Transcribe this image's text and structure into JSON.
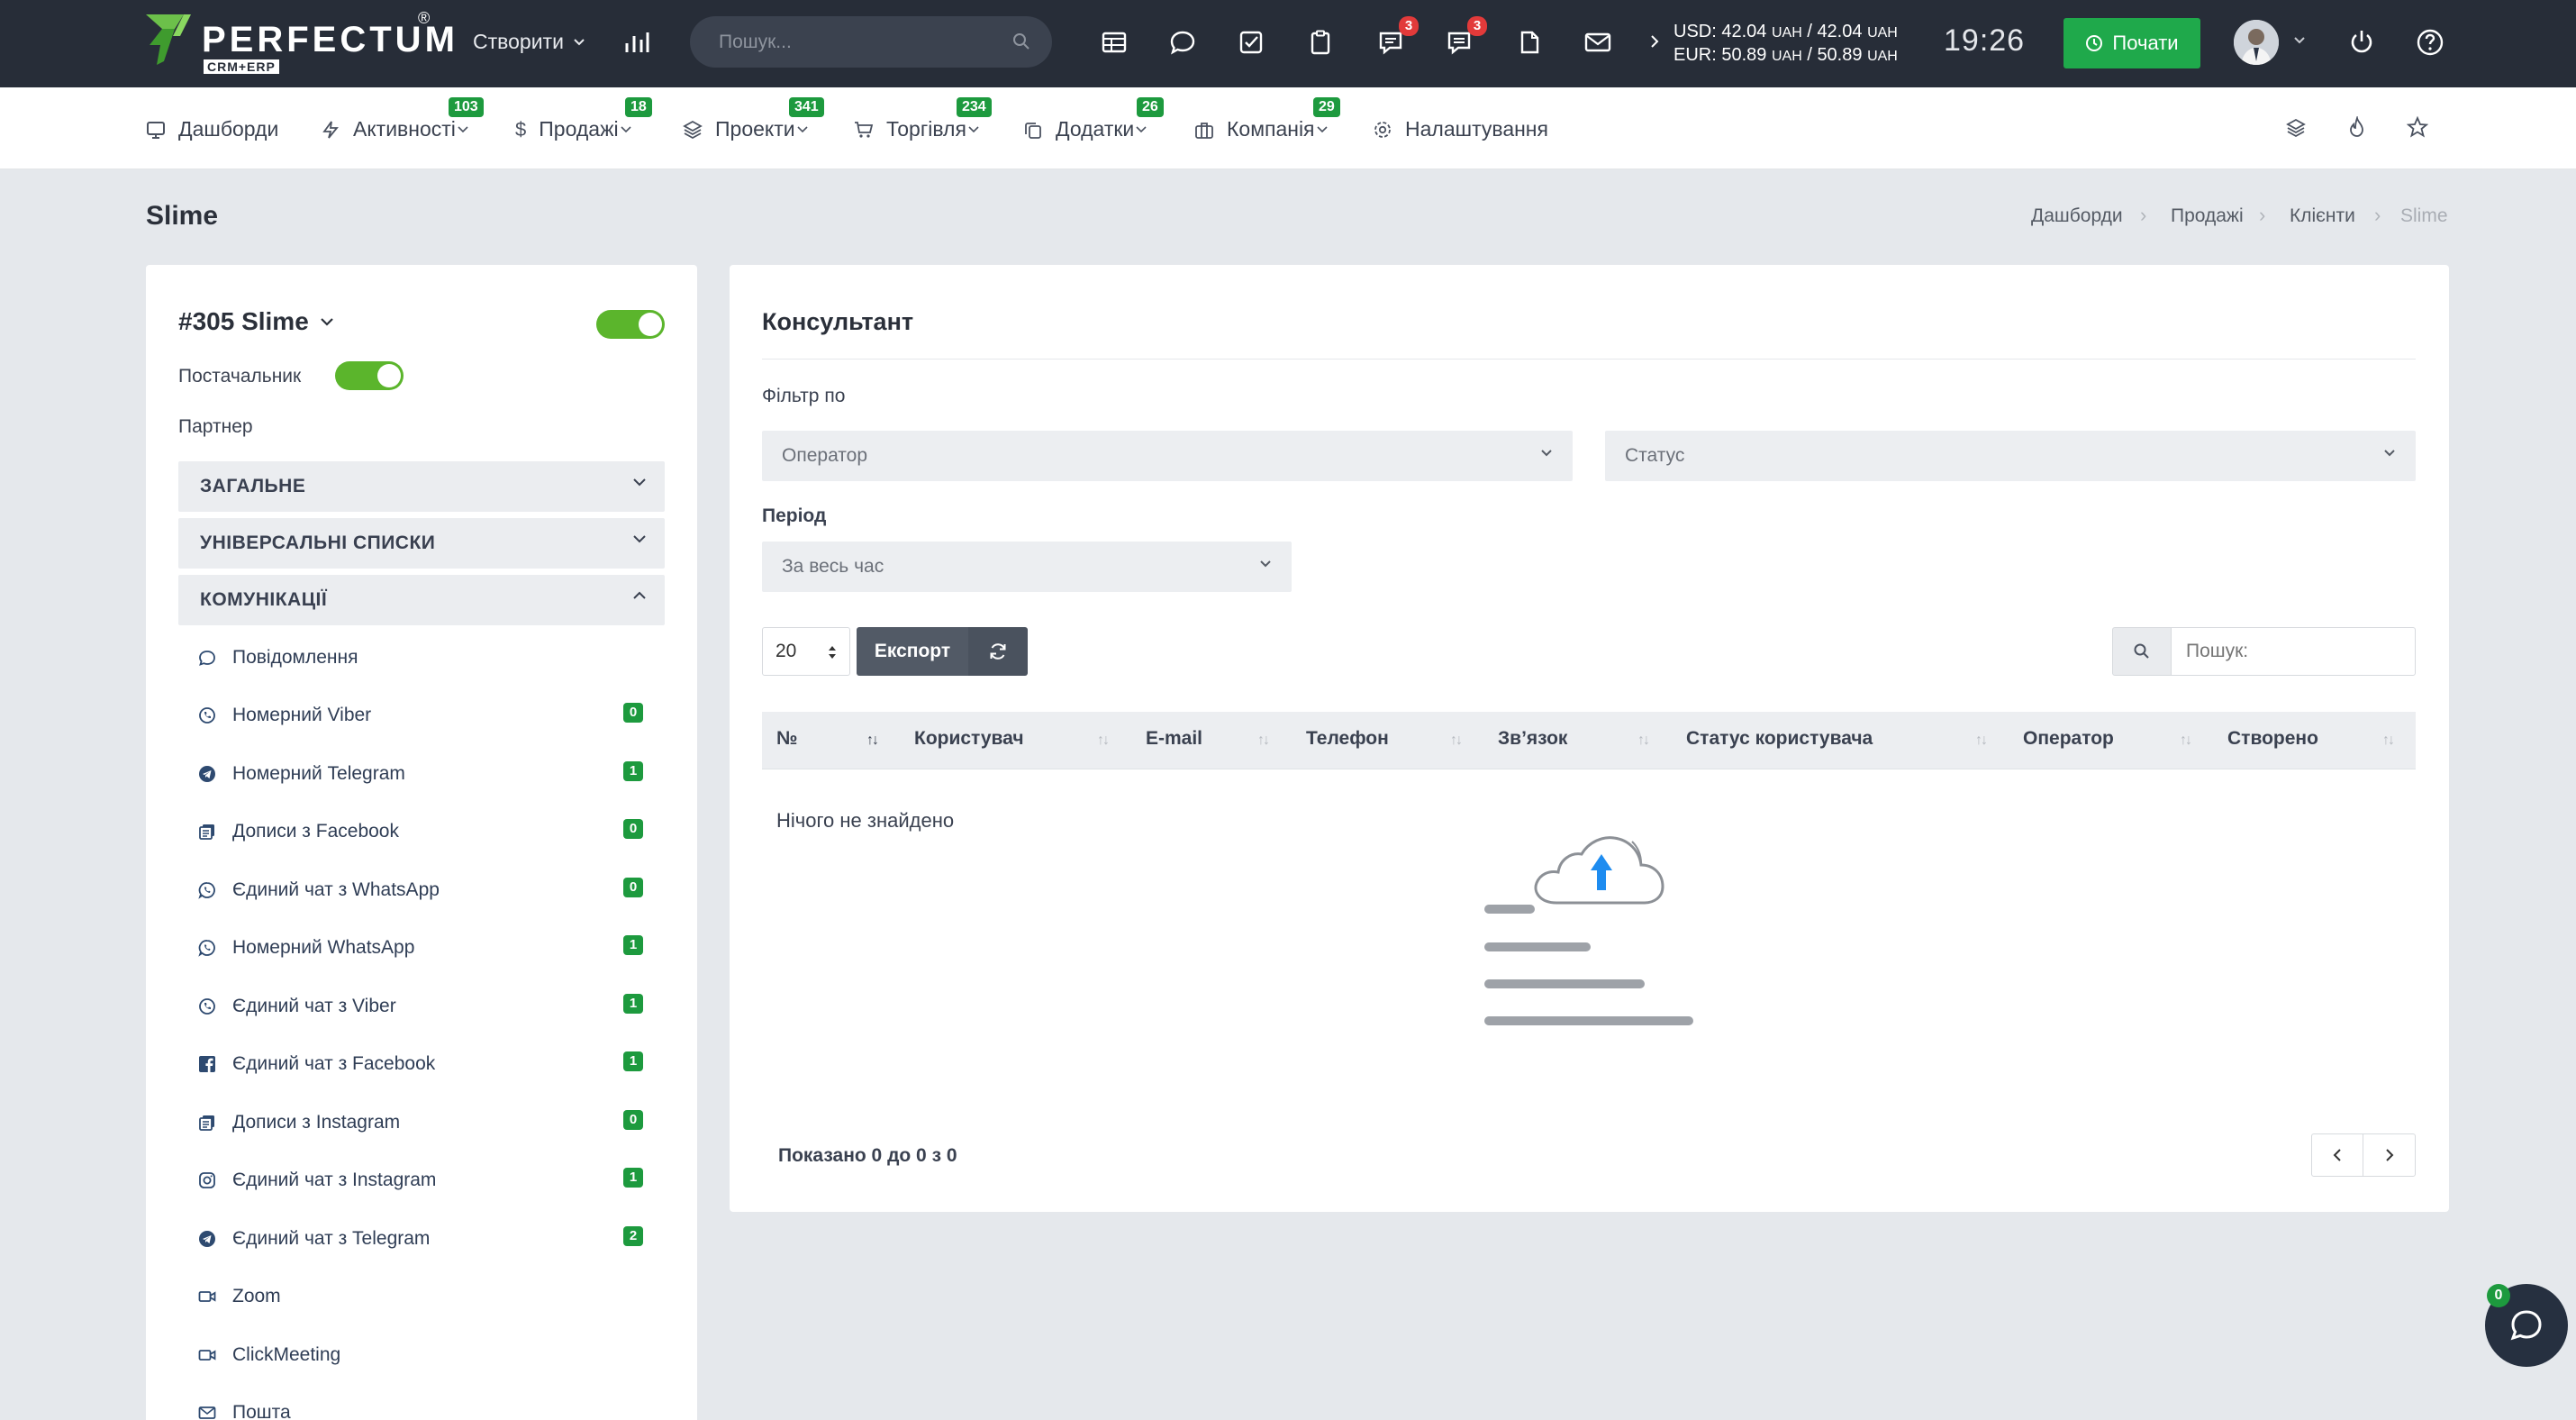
{
  "topbar": {
    "brand": "PERFECTUM",
    "brand_sub": "CRM+ERP",
    "create_label": "Створити",
    "search_placeholder": "Пошук...",
    "badges": {
      "chat": "3",
      "messages": "3"
    },
    "currency": {
      "usd_label": "USD:",
      "usd_value": "42.04",
      "usd_unit": "UAH",
      "usd_value2": "42.04",
      "eur_label": "EUR:",
      "eur_value": "50.89",
      "eur_unit": "UAH",
      "eur_value2": "50.89"
    },
    "clock": "19:26",
    "start_label": "Почати"
  },
  "menu": [
    {
      "label": "Дашборди",
      "icon": "monitor-icon",
      "badge": ""
    },
    {
      "label": "Активності",
      "icon": "bolt-icon",
      "badge": "103"
    },
    {
      "label": "Продажі",
      "icon": "dollar-icon",
      "badge": "18"
    },
    {
      "label": "Проекти",
      "icon": "layers-icon",
      "badge": "341"
    },
    {
      "label": "Торгівля",
      "icon": "cart-icon",
      "badge": "234"
    },
    {
      "label": "Додатки",
      "icon": "copy-icon",
      "badge": "26"
    },
    {
      "label": "Компанія",
      "icon": "briefcase-icon",
      "badge": "29"
    },
    {
      "label": "Налаштування",
      "icon": "gear-icon",
      "badge": ""
    }
  ],
  "page": {
    "title": "Slime",
    "breadcrumb": [
      "Дашборди",
      "Продажі",
      "Клієнти",
      "Slime"
    ]
  },
  "left": {
    "client_title": "#305 Slime",
    "supplier_label": "Постачальник",
    "partner_label": "Партнер",
    "sections": [
      "ЗАГАЛЬНЕ",
      "УНІВЕРСАЛЬНІ СПИСКИ",
      "КОМУНІКАЦІЇ"
    ],
    "communications": [
      {
        "label": "Повідомлення",
        "icon": "chat-bubble-icon",
        "count": ""
      },
      {
        "label": "Номерний Viber",
        "icon": "viber-icon",
        "count": "0"
      },
      {
        "label": "Номерний Telegram",
        "icon": "telegram-icon",
        "count": "1"
      },
      {
        "label": "Дописи з Facebook",
        "icon": "posts-icon",
        "count": "0"
      },
      {
        "label": "Єдиний чат з WhatsApp",
        "icon": "whatsapp-icon",
        "count": "0"
      },
      {
        "label": "Номерний WhatsApp",
        "icon": "whatsapp-icon",
        "count": "1"
      },
      {
        "label": "Єдиний чат з Viber",
        "icon": "viber-icon",
        "count": "1"
      },
      {
        "label": "Єдиний чат з Facebook",
        "icon": "facebook-icon",
        "count": "1"
      },
      {
        "label": "Дописи з Instagram",
        "icon": "posts-icon",
        "count": "0"
      },
      {
        "label": "Єдиний чат з Instagram",
        "icon": "instagram-icon",
        "count": "1"
      },
      {
        "label": "Єдиний чат з Telegram",
        "icon": "telegram-icon",
        "count": "2"
      },
      {
        "label": "Zoom",
        "icon": "video-icon",
        "count": ""
      },
      {
        "label": "ClickMeeting",
        "icon": "video-icon",
        "count": ""
      },
      {
        "label": "Пошта",
        "icon": "mail-icon",
        "count": ""
      }
    ]
  },
  "consultant": {
    "title": "Консультант",
    "filter_label": "Фільтр по",
    "operator_placeholder": "Оператор",
    "status_placeholder": "Статус",
    "period_label": "Період",
    "period_value": "За весь час",
    "page_size": "20",
    "export_label": "Експорт",
    "search_placeholder": "Пошук:",
    "columns": [
      "№",
      "Користувач",
      "E-mail",
      "Телефон",
      "Зв’язок",
      "Статус користувача",
      "Оператор",
      "Створено"
    ],
    "empty_text": "Нічого не знайдено",
    "shown_text": "Показано 0 до 0 з 0"
  },
  "chat_widget": {
    "count": "0"
  },
  "colors": {
    "accent_green": "#5bb52c",
    "badge_green": "#1d9a3e",
    "topbar": "#272d38",
    "badge_red": "#e23a3a"
  }
}
